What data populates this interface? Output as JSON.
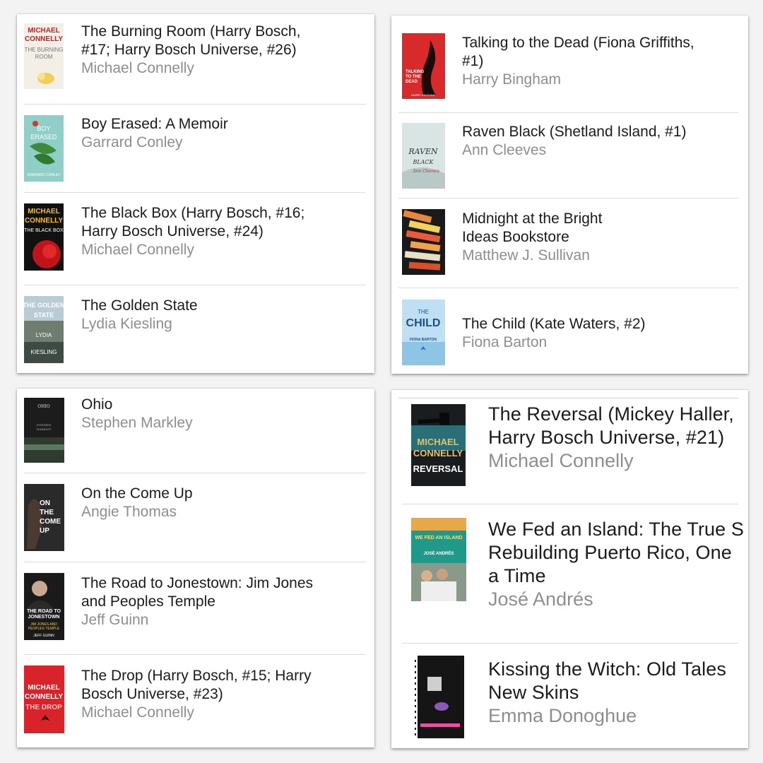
{
  "panels": [
    {
      "books": [
        {
          "title": "The Burning Room (Harry Bosch,\n#17; Harry Bosch Universe, #26)",
          "author": "Michael Connelly",
          "cover_icon": "the-burning-room-cover"
        },
        {
          "title": "Boy Erased: A Memoir",
          "author": "Garrard Conley",
          "cover_icon": "boy-erased-cover"
        },
        {
          "title": "The Black Box (Harry Bosch, #16;\nHarry Bosch Universe, #24)",
          "author": "Michael Connelly",
          "cover_icon": "the-black-box-cover"
        },
        {
          "title": "The Golden State",
          "author": "Lydia Kiesling",
          "cover_icon": "the-golden-state-cover"
        }
      ]
    },
    {
      "books": [
        {
          "title": "Talking to the Dead (Fiona Griffiths,\n#1)",
          "author": "Harry Bingham",
          "cover_icon": "talking-to-the-dead-cover"
        },
        {
          "title": "Raven Black (Shetland Island, #1)",
          "author": "Ann Cleeves",
          "cover_icon": "raven-black-cover"
        },
        {
          "title": "Midnight at the Bright\nIdeas Bookstore",
          "author": "Matthew J. Sullivan",
          "cover_icon": "midnight-bright-ideas-cover"
        },
        {
          "title": "The Child (Kate Waters, #2)",
          "author": "Fiona Barton",
          "cover_icon": "the-child-cover"
        }
      ]
    },
    {
      "books": [
        {
          "title": "Ohio",
          "author": "Stephen Markley",
          "cover_icon": "ohio-cover"
        },
        {
          "title": "On the Come Up",
          "author": "Angie Thomas",
          "cover_icon": "on-the-come-up-cover"
        },
        {
          "title": "The Road to Jonestown: Jim Jones\nand Peoples Temple",
          "author": "Jeff Guinn",
          "cover_icon": "road-to-jonestown-cover"
        },
        {
          "title": "The Drop (Harry Bosch, #15; Harry\nBosch Universe, #23)",
          "author": "Michael Connelly",
          "cover_icon": "the-drop-cover"
        }
      ]
    },
    {
      "books": [
        {
          "title": "The Reversal (Mickey Haller,\nHarry Bosch Universe, #21)",
          "author": "Michael Connelly",
          "cover_icon": "the-reversal-cover"
        },
        {
          "title": "We Fed an Island: The True S\nRebuilding Puerto Rico, One\na Time",
          "author": "José Andrés",
          "cover_icon": "we-fed-an-island-cover"
        },
        {
          "title": "Kissing the Witch: Old Tales\nNew Skins",
          "author": "Emma Donoghue",
          "cover_icon": "kissing-the-witch-cover"
        }
      ]
    }
  ],
  "cover_text": {
    "connelly_author": "MICHAEL CONNELLY",
    "burning_room": "THE BURNING ROOM",
    "black_box": "THE BLACK BOX",
    "the_drop": "THE DROP",
    "reversal": "REVERSAL",
    "boy_erased": "BOY ERASED",
    "golden_state": "THE GOLDEN STATE",
    "lydia": "LYDIA KIESLING",
    "talking": "TALKING TO THE DEAD",
    "raven_black": "RAVEN BLACK",
    "ann_cleeves": "Ann Cleeves",
    "midnight": "MIDNIGHT AT THE BRIGHT IDEAS BOOKSTORE",
    "the_child": "THE CHILD",
    "fiona": "FIONA BARTON",
    "ohio": "OHIO",
    "markley": "STEPHEN MARKLEY",
    "come_up": "ON THE COME UP",
    "jonestown": "THE ROAD TO JONESTOWN",
    "jim_jones": "JIM JONES AND PEOPLES TEMPLE",
    "jeff_guinn": "JEFF GUINN",
    "we_fed": "WE FED AN ISLAND",
    "jose": "JOSÉ ANDRÉS"
  },
  "colors": {
    "background": "#f3f3f3",
    "panel": "#ffffff",
    "title_text": "#1b1b1b",
    "author_text": "#8e8e8e",
    "separator": "#dcdcdc"
  }
}
